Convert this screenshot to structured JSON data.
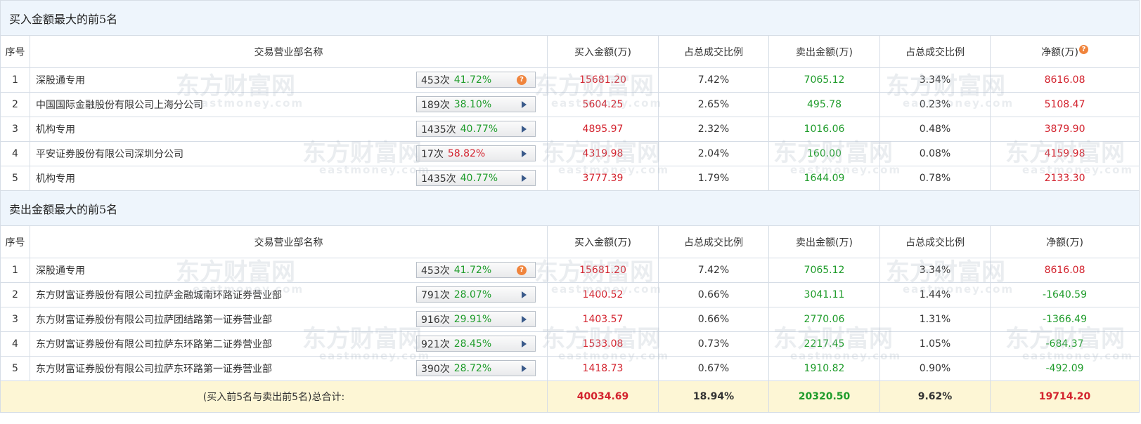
{
  "buy_section": {
    "title": "买入金额最大的前5名",
    "headers": {
      "idx": "序号",
      "name": "交易营业部名称",
      "buy": "买入金额(万)",
      "buy_ratio": "占总成交比例",
      "sell": "卖出金额(万)",
      "sell_ratio": "占总成交比例",
      "net": "净额(万)"
    },
    "rows": [
      {
        "idx": "1",
        "name": "深股通专用",
        "count": "453次",
        "rate": "41.72%",
        "rate_color": "green",
        "marker": "question",
        "buy": "15681.20",
        "buy_ratio": "7.42%",
        "sell": "7065.12",
        "sell_ratio": "3.34%",
        "net": "8616.08",
        "net_color": "red"
      },
      {
        "idx": "2",
        "name": "中国国际金融股份有限公司上海分公司",
        "count": "189次",
        "rate": "38.10%",
        "rate_color": "green",
        "marker": "arrow",
        "buy": "5604.25",
        "buy_ratio": "2.65%",
        "sell": "495.78",
        "sell_ratio": "0.23%",
        "net": "5108.47",
        "net_color": "red"
      },
      {
        "idx": "3",
        "name": "机构专用",
        "count": "1435次",
        "rate": "40.77%",
        "rate_color": "green",
        "marker": "arrow",
        "buy": "4895.97",
        "buy_ratio": "2.32%",
        "sell": "1016.06",
        "sell_ratio": "0.48%",
        "net": "3879.90",
        "net_color": "red"
      },
      {
        "idx": "4",
        "name": "平安证券股份有限公司深圳分公司",
        "count": "17次",
        "rate": "58.82%",
        "rate_color": "red",
        "marker": "arrow",
        "buy": "4319.98",
        "buy_ratio": "2.04%",
        "sell": "160.00",
        "sell_ratio": "0.08%",
        "net": "4159.98",
        "net_color": "red"
      },
      {
        "idx": "5",
        "name": "机构专用",
        "count": "1435次",
        "rate": "40.77%",
        "rate_color": "green",
        "marker": "arrow",
        "buy": "3777.39",
        "buy_ratio": "1.79%",
        "sell": "1644.09",
        "sell_ratio": "0.78%",
        "net": "2133.30",
        "net_color": "red"
      }
    ]
  },
  "sell_section": {
    "title": "卖出金额最大的前5名",
    "headers": {
      "idx": "序号",
      "name": "交易营业部名称",
      "buy": "买入金额(万)",
      "buy_ratio": "占总成交比例",
      "sell": "卖出金额(万)",
      "sell_ratio": "占总成交比例",
      "net": "净额(万)"
    },
    "rows": [
      {
        "idx": "1",
        "name": "深股通专用",
        "count": "453次",
        "rate": "41.72%",
        "rate_color": "green",
        "marker": "question",
        "buy": "15681.20",
        "buy_ratio": "7.42%",
        "sell": "7065.12",
        "sell_ratio": "3.34%",
        "net": "8616.08",
        "net_color": "red"
      },
      {
        "idx": "2",
        "name": "东方财富证券股份有限公司拉萨金融城南环路证券营业部",
        "count": "791次",
        "rate": "28.07%",
        "rate_color": "green",
        "marker": "arrow",
        "buy": "1400.52",
        "buy_ratio": "0.66%",
        "sell": "3041.11",
        "sell_ratio": "1.44%",
        "net": "-1640.59",
        "net_color": "green"
      },
      {
        "idx": "3",
        "name": "东方财富证券股份有限公司拉萨团结路第一证券营业部",
        "count": "916次",
        "rate": "29.91%",
        "rate_color": "green",
        "marker": "arrow",
        "buy": "1403.57",
        "buy_ratio": "0.66%",
        "sell": "2770.06",
        "sell_ratio": "1.31%",
        "net": "-1366.49",
        "net_color": "green"
      },
      {
        "idx": "4",
        "name": "东方财富证券股份有限公司拉萨东环路第二证券营业部",
        "count": "921次",
        "rate": "28.45%",
        "rate_color": "green",
        "marker": "arrow",
        "buy": "1533.08",
        "buy_ratio": "0.73%",
        "sell": "2217.45",
        "sell_ratio": "1.05%",
        "net": "-684.37",
        "net_color": "green"
      },
      {
        "idx": "5",
        "name": "东方财富证券股份有限公司拉萨东环路第一证券营业部",
        "count": "390次",
        "rate": "28.72%",
        "rate_color": "green",
        "marker": "arrow",
        "buy": "1418.73",
        "buy_ratio": "0.67%",
        "sell": "1910.82",
        "sell_ratio": "0.90%",
        "net": "-492.09",
        "net_color": "green"
      }
    ]
  },
  "total": {
    "label": "(买入前5名与卖出前5名)总合计:",
    "buy": "40034.69",
    "buy_ratio": "18.94%",
    "sell": "20320.50",
    "sell_ratio": "9.62%",
    "net": "19714.20"
  },
  "watermark": {
    "cn": "东方财富网",
    "en": "eastmoney.com"
  },
  "help_glyph": "?",
  "colors": {
    "red": "#d3232e",
    "green": "#1f9c2b",
    "header_bg": "#eef5fc",
    "total_bg": "#fdf6d5",
    "question_badge": "#f0843c"
  }
}
